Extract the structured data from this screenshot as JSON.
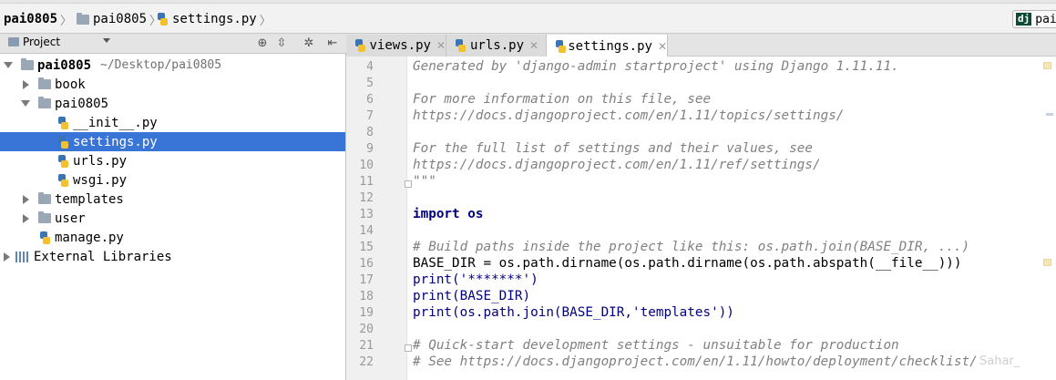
{
  "breadcrumb": {
    "items": [
      {
        "label": "pai0805",
        "icon": "folder-icon"
      },
      {
        "label": "pai0805",
        "icon": "folder-icon"
      },
      {
        "label": "settings.py",
        "icon": "python-file-icon"
      }
    ]
  },
  "run_config": {
    "badge": "dj",
    "label": "pai"
  },
  "project_panel": {
    "title": "Project",
    "tree": [
      {
        "name": "pai0805",
        "hint": "~/Desktop/pai0805",
        "type": "folder",
        "expanded": true,
        "bold": true
      },
      {
        "name": "book",
        "type": "folder",
        "expanded": false
      },
      {
        "name": "pai0805",
        "type": "folder",
        "expanded": true
      },
      {
        "name": "__init__.py",
        "type": "python-file"
      },
      {
        "name": "settings.py",
        "type": "python-file",
        "selected": true
      },
      {
        "name": "urls.py",
        "type": "python-file"
      },
      {
        "name": "wsgi.py",
        "type": "python-file"
      },
      {
        "name": "templates",
        "type": "folder",
        "expanded": false
      },
      {
        "name": "user",
        "type": "folder",
        "expanded": false
      },
      {
        "name": "manage.py",
        "type": "python-file"
      },
      {
        "name": "External Libraries",
        "type": "library",
        "expanded": false
      }
    ]
  },
  "editor_tabs": [
    {
      "label": "views.py",
      "active": false
    },
    {
      "label": "urls.py",
      "active": false
    },
    {
      "label": "settings.py",
      "active": true
    }
  ],
  "editor": {
    "lines": [
      {
        "num": "4",
        "text": "Generated by 'django-admin startproject' using Django 1.11.11."
      },
      {
        "num": "5",
        "text": ""
      },
      {
        "num": "6",
        "text": "For more information on this file, see"
      },
      {
        "num": "7",
        "text": "https://docs.djangoproject.com/en/1.11/topics/settings/"
      },
      {
        "num": "8",
        "text": ""
      },
      {
        "num": "9",
        "text": "For the full list of settings and their values, see"
      },
      {
        "num": "10",
        "text": "https://docs.djangoproject.com/en/1.11/ref/settings/"
      },
      {
        "num": "11",
        "text": "\"\"\""
      },
      {
        "num": "12",
        "text": ""
      },
      {
        "num": "13",
        "text": "import os"
      },
      {
        "num": "14",
        "text": ""
      },
      {
        "num": "15",
        "text": "# Build paths inside the project like this: os.path.join(BASE_DIR, ...)"
      },
      {
        "num": "16",
        "text": "BASE_DIR = os.path.dirname(os.path.dirname(os.path.abspath(__file__)))"
      },
      {
        "num": "17",
        "text": "print('*******')"
      },
      {
        "num": "18",
        "text": "print(BASE_DIR)"
      },
      {
        "num": "19",
        "text": "print(os.path.join(BASE_DIR,'templates'))"
      },
      {
        "num": "20",
        "text": ""
      },
      {
        "num": "21",
        "text": "# Quick-start development settings - unsuitable for production"
      },
      {
        "num": "22",
        "text": "# See https://docs.djangoproject.com/en/1.11/howto/deployment/checklist/"
      }
    ]
  },
  "watermark": "Sahar_"
}
